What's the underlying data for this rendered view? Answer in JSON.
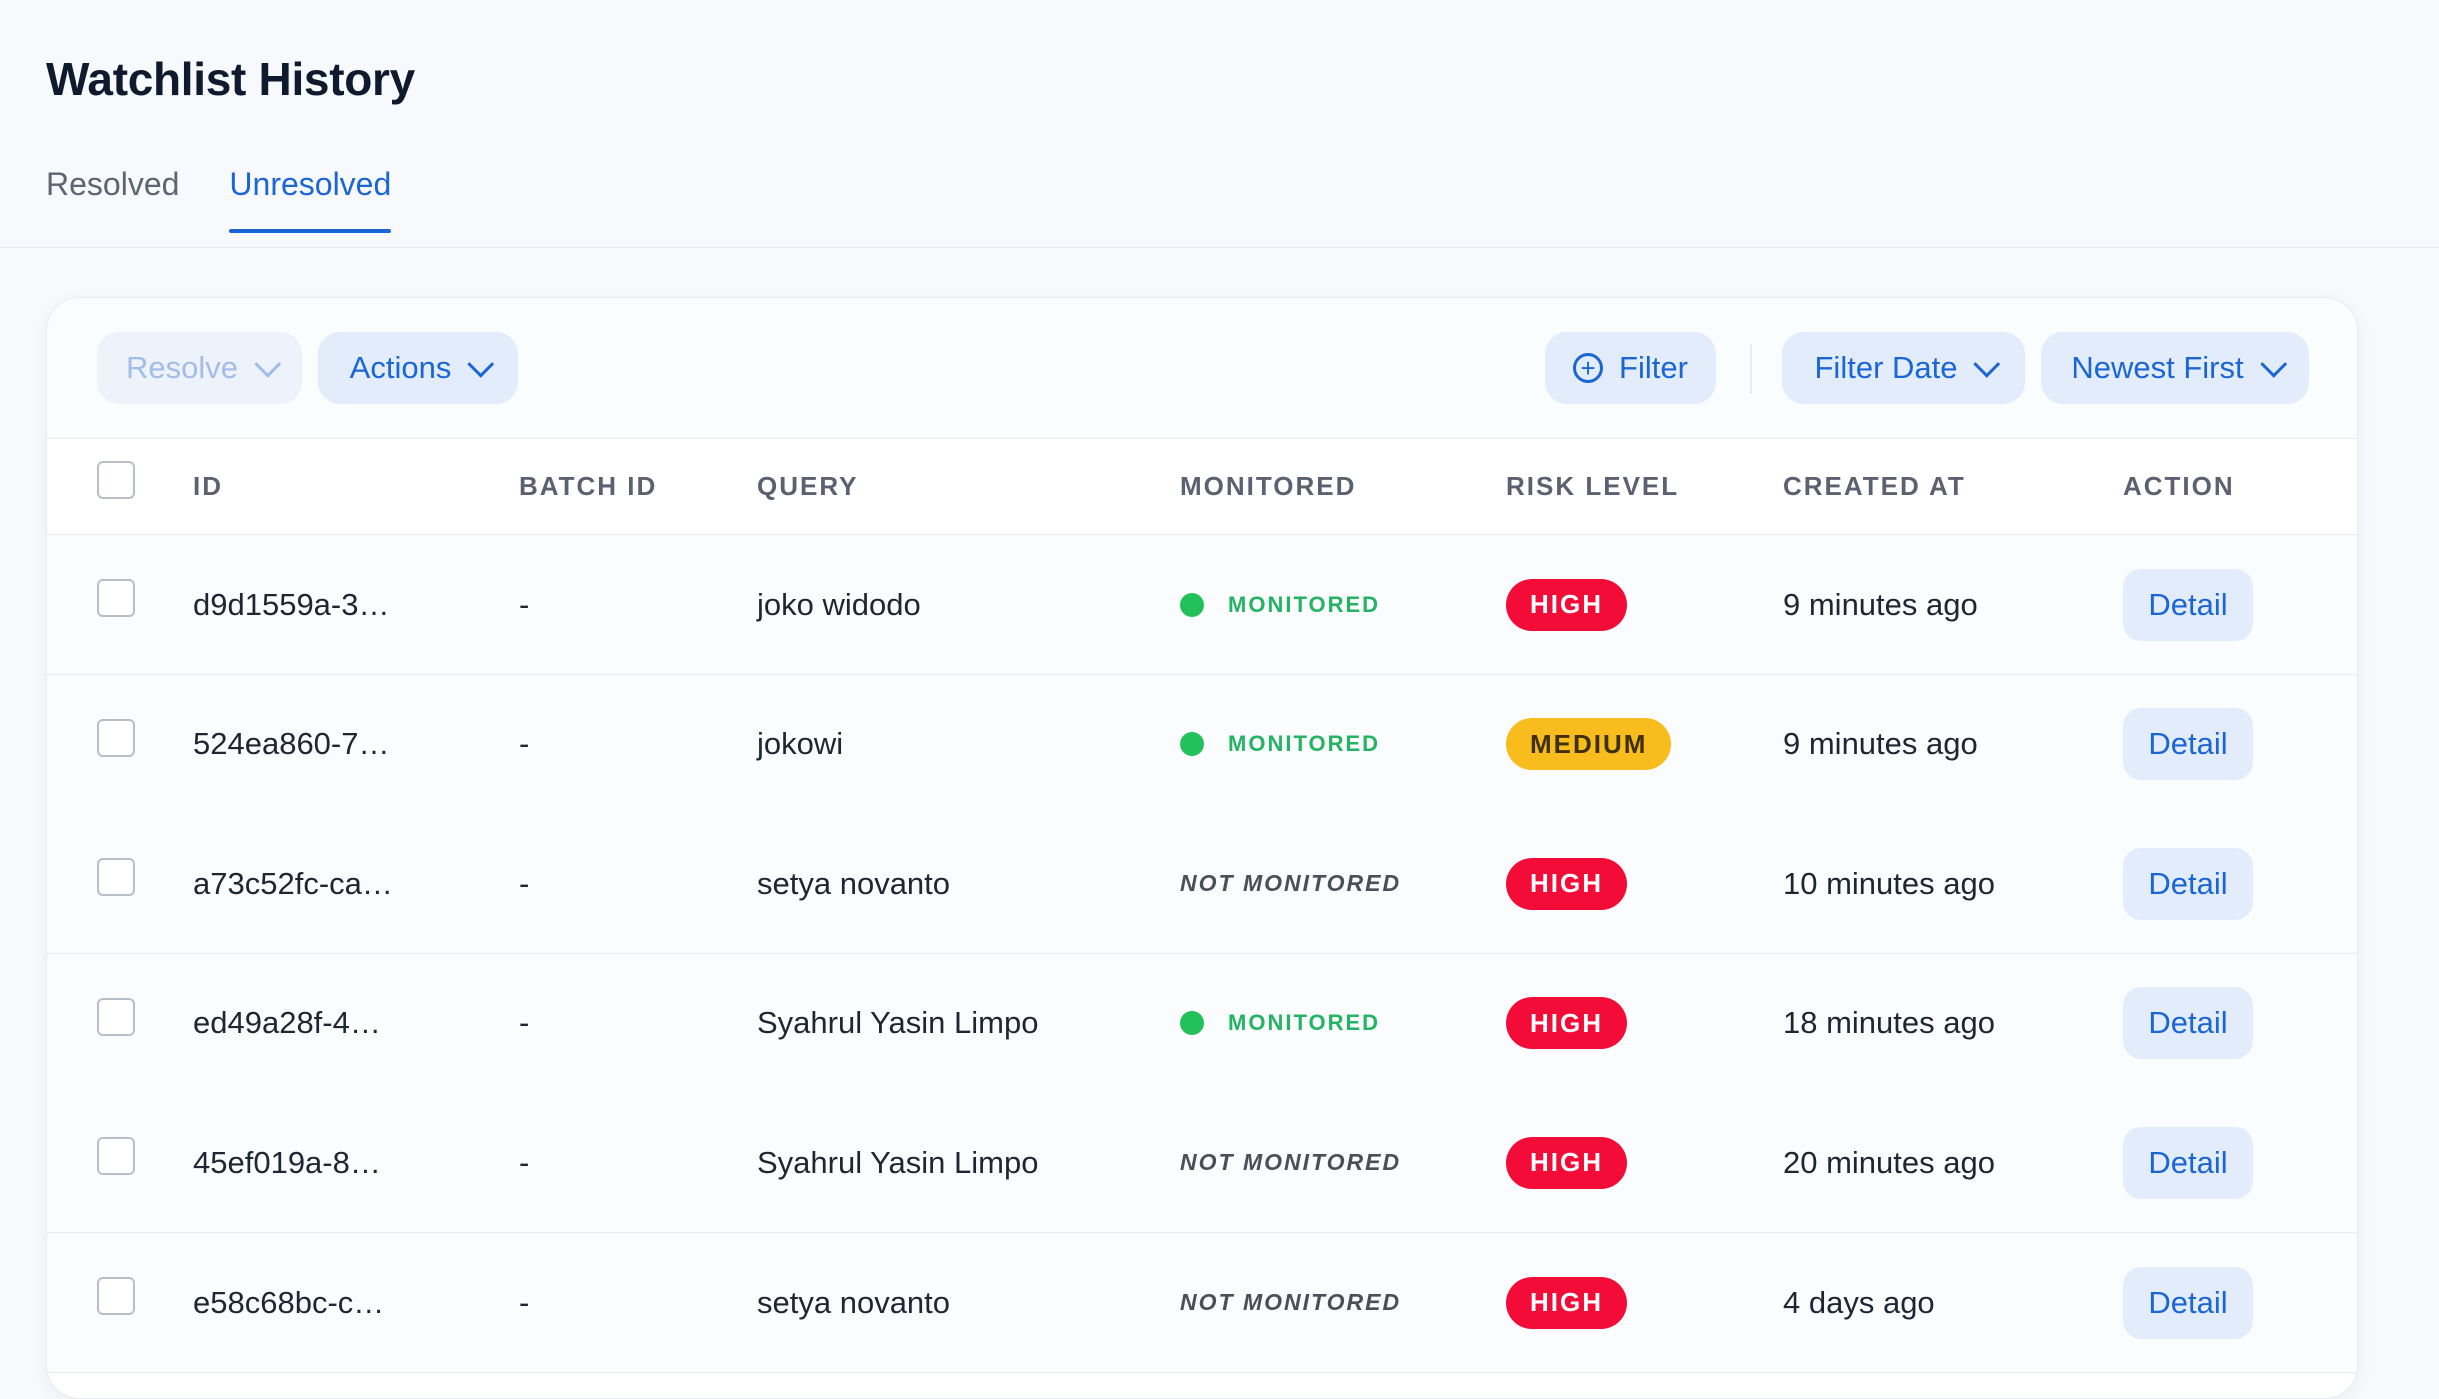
{
  "page": {
    "title": "Watchlist History"
  },
  "tabs": [
    {
      "label": "Resolved",
      "active": false
    },
    {
      "label": "Unresolved",
      "active": true
    }
  ],
  "toolbar": {
    "resolve_label": "Resolve",
    "actions_label": "Actions",
    "filter_label": "Filter",
    "filter_date_label": "Filter Date",
    "sort_label": "Newest First"
  },
  "table": {
    "headers": {
      "id": "ID",
      "batch_id": "BATCH ID",
      "query": "QUERY",
      "monitored": "MONITORED",
      "risk_level": "RISK LEVEL",
      "created_at": "CREATED AT",
      "action": "ACTION"
    },
    "rows": [
      {
        "id": "d9d1559a-3…",
        "batch_id": "-",
        "query": "joko widodo",
        "monitored": true,
        "monitored_label": "MONITORED",
        "risk": "HIGH",
        "risk_level": "high",
        "created_at": "9 minutes ago",
        "action": "Detail"
      },
      {
        "id": "524ea860-7…",
        "batch_id": "-",
        "query": "jokowi",
        "monitored": true,
        "monitored_label": "MONITORED",
        "risk": "MEDIUM",
        "risk_level": "medium",
        "created_at": "9 minutes ago",
        "action": "Detail"
      },
      {
        "id": "a73c52fc-ca…",
        "batch_id": "-",
        "query": "setya novanto",
        "monitored": false,
        "monitored_label": "NOT MONITORED",
        "risk": "HIGH",
        "risk_level": "high",
        "created_at": "10 minutes ago",
        "action": "Detail"
      },
      {
        "id": "ed49a28f-4…",
        "batch_id": "-",
        "query": "Syahrul Yasin Limpo",
        "monitored": true,
        "monitored_label": "MONITORED",
        "risk": "HIGH",
        "risk_level": "high",
        "created_at": "18 minutes ago",
        "action": "Detail"
      },
      {
        "id": "45ef019a-8…",
        "batch_id": "-",
        "query": "Syahrul Yasin Limpo",
        "monitored": false,
        "monitored_label": "NOT MONITORED",
        "risk": "HIGH",
        "risk_level": "high",
        "created_at": "20 minutes ago",
        "action": "Detail"
      },
      {
        "id": "e58c68bc-c…",
        "batch_id": "-",
        "query": "setya novanto",
        "monitored": false,
        "monitored_label": "NOT MONITORED",
        "risk": "HIGH",
        "risk_level": "high",
        "created_at": "4 days ago",
        "action": "Detail"
      }
    ]
  },
  "colors": {
    "accent": "#1b66d6",
    "high": "#f20c37",
    "medium": "#f8bd1c",
    "monitored": "#22c15a"
  }
}
